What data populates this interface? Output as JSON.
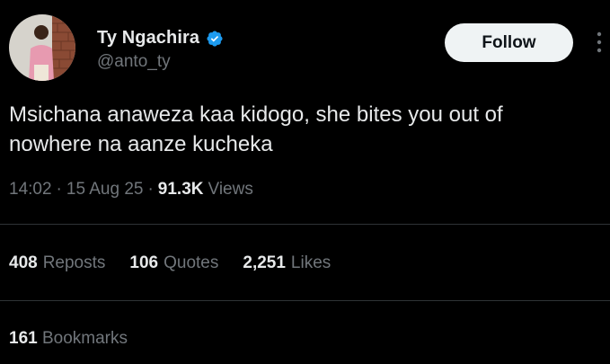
{
  "author": {
    "display_name": "Ty Ngachira",
    "handle": "@anto_ty",
    "verified": true
  },
  "follow_button": {
    "label": "Follow"
  },
  "tweet": {
    "text_line_1": "Msichana anaweza kaa kidogo, she bites you out of",
    "text_line_2": "nowhere na aanze kucheka"
  },
  "meta": {
    "time": "14:02",
    "separator": "·",
    "date": "15 Aug 25",
    "views_count": "91.3K",
    "views_label": "Views"
  },
  "stats": {
    "reposts": {
      "count": "408",
      "label": "Reposts"
    },
    "quotes": {
      "count": "106",
      "label": "Quotes"
    },
    "likes": {
      "count": "2,251",
      "label": "Likes"
    },
    "bookmarks": {
      "count": "161",
      "label": "Bookmarks"
    }
  },
  "icons": {
    "verified": "verified-badge-icon",
    "more": "more-options-icon"
  },
  "colors": {
    "background": "#000000",
    "primary_text": "#e7e9ea",
    "secondary_text": "#71767b",
    "verified_blue": "#1d9bf0",
    "follow_button_bg": "#eff3f4",
    "divider": "#2f3336"
  }
}
